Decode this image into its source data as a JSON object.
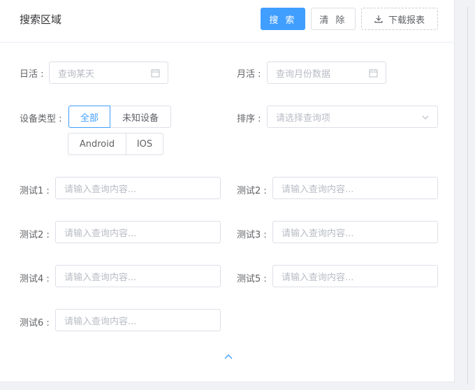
{
  "header": {
    "title": "搜索区域",
    "search_label": "搜 索",
    "clear_label": "清 除",
    "download_label": "下载报表"
  },
  "form": {
    "daily": {
      "label": "日活 :",
      "placeholder": "查询某天"
    },
    "monthly": {
      "label": "月活 :",
      "placeholder": "查询月份数据"
    },
    "device": {
      "label": "设备类型 :",
      "options": [
        "全部",
        "未知设备",
        "Android",
        "IOS"
      ],
      "selected": "全部"
    },
    "sort": {
      "label": "排序 :",
      "placeholder": "请选择查询项"
    },
    "tests": [
      {
        "label": "测试1 :",
        "placeholder": "请输入查询内容..."
      },
      {
        "label": "测试2 :",
        "placeholder": "请输入查询内容..."
      },
      {
        "label": "测试2 :",
        "placeholder": "请输入查询内容..."
      },
      {
        "label": "测试3 :",
        "placeholder": "请输入查询内容..."
      },
      {
        "label": "测试4 :",
        "placeholder": "请输入查询内容..."
      },
      {
        "label": "测试5 :",
        "placeholder": "请输入查询内容..."
      },
      {
        "label": "测试6 :",
        "placeholder": "请输入查询内容..."
      }
    ]
  },
  "icons": {
    "calendar": "calendar-icon",
    "download": "download-icon",
    "chevron_down": "chevron-down-icon",
    "collapse": "chevron-up-icon"
  },
  "colors": {
    "accent": "#409eff",
    "border": "#dcdfe6",
    "placeholder": "#b8bcc4"
  }
}
